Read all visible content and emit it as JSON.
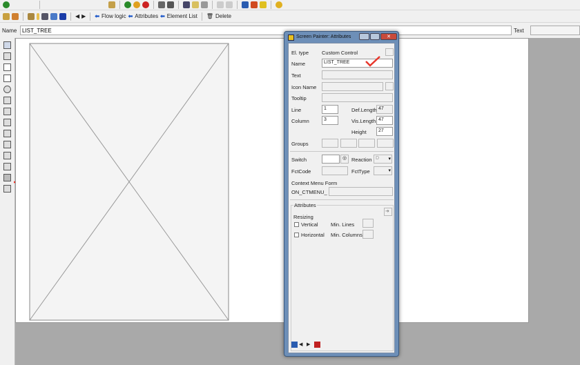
{
  "toolbar2": {
    "flow_logic": "Flow logic",
    "attributes": "Attributes",
    "element_list": "Element List",
    "delete": "Delete"
  },
  "namebar": {
    "name_label": "Name",
    "name_value": "LIST_TREE",
    "text_label": "Text"
  },
  "dialog": {
    "title": "Screen Painter: Attributes",
    "el_type_label": "El. type",
    "el_type_value": "Custom Control",
    "name_label": "Name",
    "name_value": "LIST_TREE",
    "text_label": "Text",
    "icon_name_label": "Icon Name",
    "tooltip_label": "Tooltip",
    "line_label": "Line",
    "line_value": "1",
    "column_label": "Column",
    "column_value": "3",
    "def_length_label": "Def.Length",
    "def_length_value": "47",
    "vis_length_label": "Vis.Length",
    "vis_length_value": "47",
    "height_label": "Height",
    "height_value": "27",
    "groups_label": "Groups",
    "switch_label": "Switch",
    "reaction_label": "Reaction",
    "reaction_value": "D",
    "fctcode_label": "FctCode",
    "fcttype_label": "FctType",
    "context_menu_label": "Context Menu Form",
    "context_menu_prefix": "ON_CTMENU_",
    "attributes_group": "Attributes",
    "resizing_label": "Resizing",
    "vertical_label": "Vertical",
    "horizontal_label": "Horizontal",
    "min_lines_label": "Min. Lines",
    "min_columns_label": "Min. Columns"
  },
  "colors": {
    "annotation": "#e8372c",
    "link_arrow": "#1a55c8"
  }
}
